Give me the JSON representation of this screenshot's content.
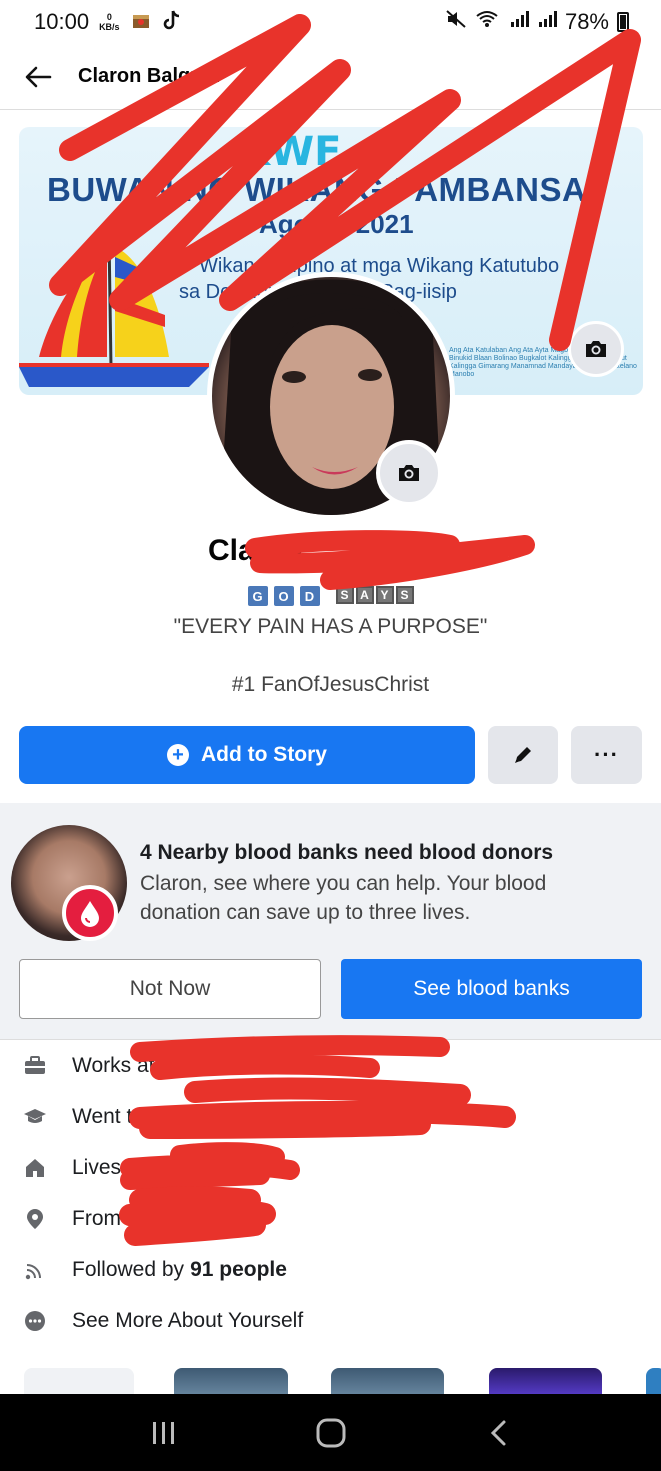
{
  "status_bar": {
    "time": "10:00",
    "data_speed": "0",
    "data_unit": "KB/s",
    "battery": "78%"
  },
  "header": {
    "name": "Claron Balquin"
  },
  "cover": {
    "logo": "KWF",
    "headline": "BUWAN NG WIKANG PAMBANSA",
    "subtitle": "Agosto 2021",
    "line1": "Wikang Filipino at mga Wikang Katutubo",
    "line2": "sa Dekolonisasyon ng Pag-iisip",
    "languages": "Ang Ata Katulaban Ang Ata Ayta Magbukun Bantoanon Binukid Blaan Bolinao Bugkalot Kalingga Kalingga Butbut Kalingga Gimarang Manamnad Mandaya Mansaka Catelano Manobo"
  },
  "profile": {
    "name": "Claron",
    "bio_badges": [
      "G",
      "O",
      "D"
    ],
    "bio_word": [
      "S",
      "A",
      "Y",
      "S"
    ],
    "bio_quote": "\"EVERY PAIN HAS A PURPOSE\"",
    "bio_tag": "#1 FanOfJesusChrist"
  },
  "actions": {
    "add_story": "Add to Story",
    "more": "···"
  },
  "blood_card": {
    "title": "4 Nearby blood banks need blood donors",
    "text": "Claron, see where you can help. Your blood donation can save up to three lives.",
    "not_now": "Not Now",
    "see_banks": "See blood banks"
  },
  "details": {
    "works": "Works at",
    "went": "Went to",
    "lives": "Lives in",
    "from": "From",
    "followed_prefix": "Followed by",
    "followed_count": "91 people",
    "see_more": "See More About Yourself"
  },
  "colors": {
    "accent": "#1877f2",
    "blood": "#e41e3f",
    "scribble": "#e8332b"
  }
}
